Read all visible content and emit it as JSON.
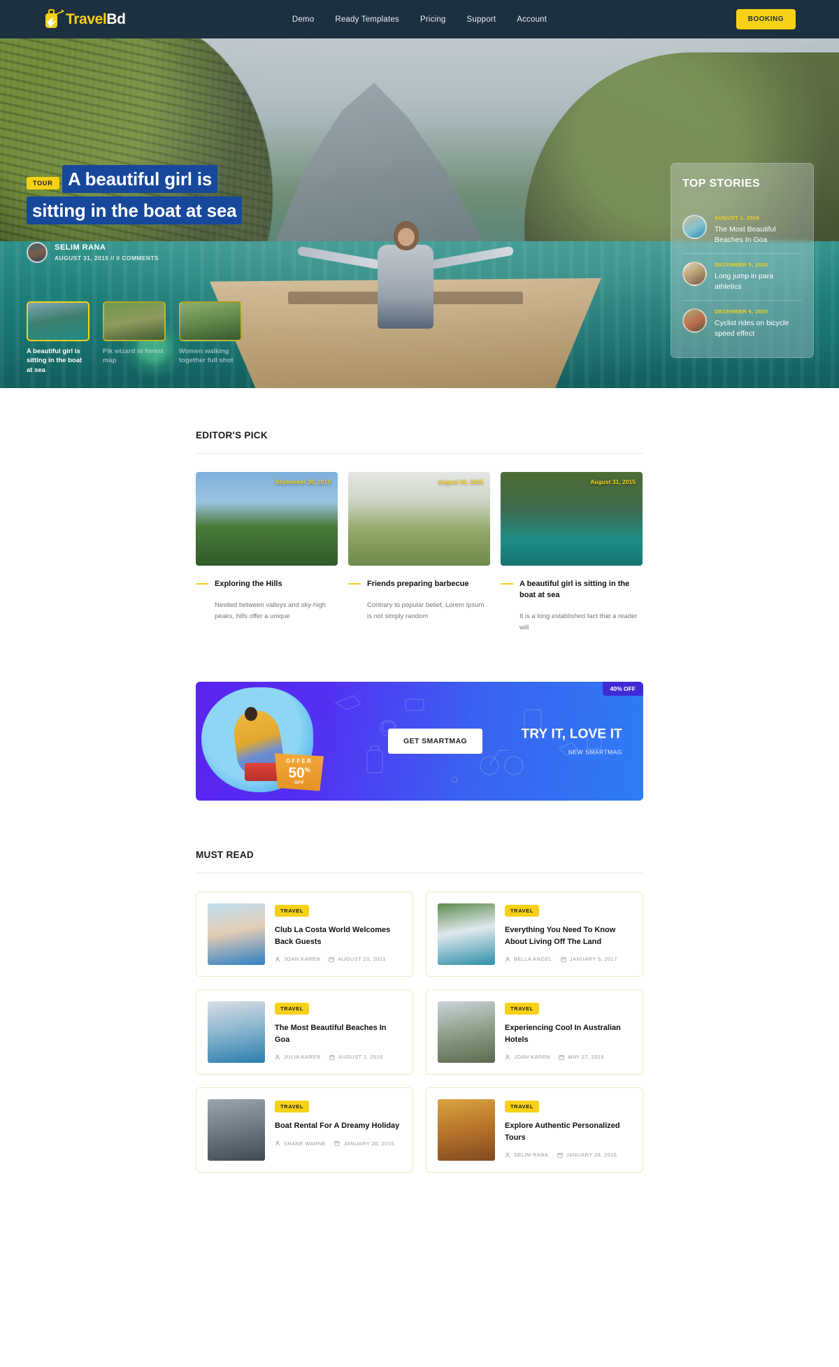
{
  "header": {
    "logo": {
      "part1": "Travel",
      "part2": "Bd",
      "icon": "luggage-plane-icon"
    },
    "nav": [
      {
        "label": "Demo"
      },
      {
        "label": "Ready Templates"
      },
      {
        "label": "Pricing"
      },
      {
        "label": "Support"
      },
      {
        "label": "Account"
      }
    ],
    "booking_label": "BOOKING",
    "bg_color": "#1d3040",
    "accent_color": "#f7d117"
  },
  "hero": {
    "tag": "TOUR",
    "title": "A beautiful girl is sitting in the boat at sea",
    "title_bg": "#17489b",
    "author": "SELIM RANA",
    "meta": "AUGUST 31, 2015   //   0 COMMENTS",
    "top_stories": {
      "title": "TOP STORIES",
      "items": [
        {
          "date": "AUGUST 1, 2016",
          "headline": "The Most Beautiful Beaches In Goa"
        },
        {
          "date": "DECEMBER 5, 2020",
          "headline": "Long jump in para athletics"
        },
        {
          "date": "DECEMBER 6, 2020",
          "headline": "Cyclist rides on bicycle speed effect"
        }
      ]
    },
    "carousel": [
      {
        "caption": "A beautiful girl is sitting in the boat at sea",
        "active": true
      },
      {
        "caption": "Pik wizard in forest map",
        "active": false
      },
      {
        "caption": "Women walking together full shot",
        "active": false
      }
    ]
  },
  "editors_pick": {
    "heading": "EDITOR'S PICK",
    "cards": [
      {
        "date": "September 30, 2015",
        "title": "Exploring the Hills",
        "excerpt": "Nestled between valleys and sky-high peaks, hills offer a unique"
      },
      {
        "date": "August 31, 2015",
        "title": "Friends preparing barbecue",
        "excerpt": "Contrary to popular belief, Lorem Ipsum is not simply random"
      },
      {
        "date": "August 31, 2015",
        "title": "A beautiful girl is sitting in the boat at sea",
        "excerpt": "It is a long established fact that a reader will"
      }
    ]
  },
  "promo": {
    "badge": "40% OFF",
    "button_label": "GET SMARTMAG",
    "headline": "TRY IT, LOVE IT",
    "subline": "NEW SMARTMAG",
    "offer_line1": "OFFER",
    "offer_value": "50",
    "offer_percent": "%",
    "offer_line3": "OFF"
  },
  "must_read": {
    "heading": "MUST READ",
    "cards": [
      {
        "chip": "TRAVEL",
        "title": "Club La Costa World Welcomes Back Guests",
        "author": "JOAN KAREN",
        "date": "AUGUST 23, 2021"
      },
      {
        "chip": "TRAVEL",
        "title": "Everything You Need To Know About Living Off The Land",
        "author": "BELLA ANGEL",
        "date": "JANUARY 5, 2017"
      },
      {
        "chip": "TRAVEL",
        "title": "The Most Beautiful Beaches In Goa",
        "author": "JULIA KAREN",
        "date": "AUGUST 1, 2016"
      },
      {
        "chip": "TRAVEL",
        "title": "Experiencing Cool In Australian Hotels",
        "author": "JOAN KAREN",
        "date": "MAY 27, 2016"
      },
      {
        "chip": "TRAVEL",
        "title": "Boat Rental For A Dreamy Holiday",
        "author": "SHANE WARNE",
        "date": "JANUARY 28, 2016"
      },
      {
        "chip": "TRAVEL",
        "title": "Explore Authentic Personalized Tours",
        "author": "SELIM RANA",
        "date": "JANUARY 28, 2016"
      }
    ]
  }
}
